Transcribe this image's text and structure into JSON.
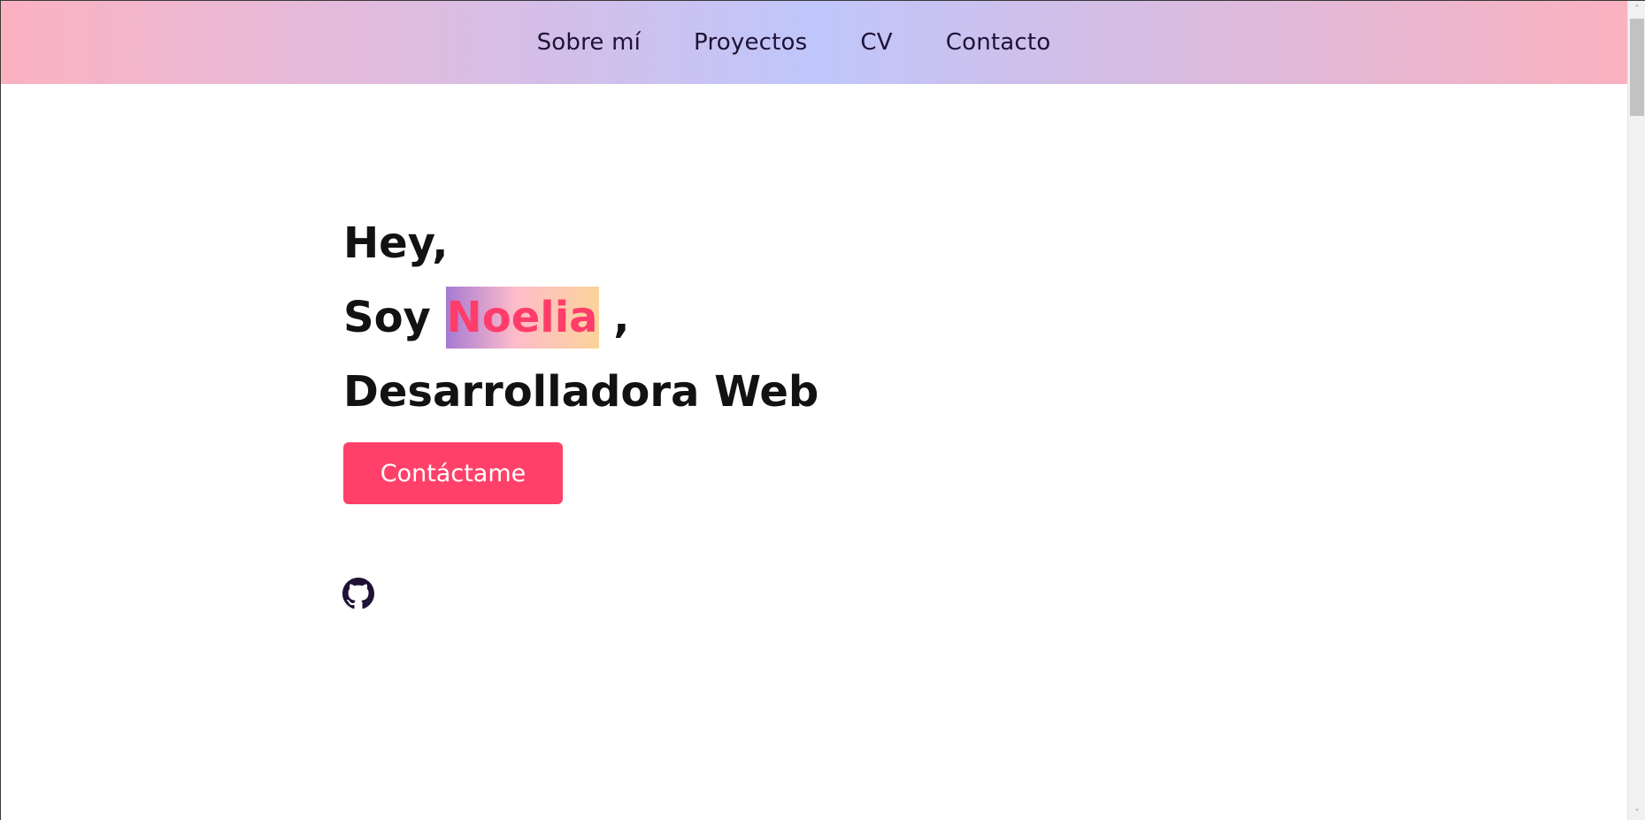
{
  "nav": {
    "items": [
      {
        "label": "Sobre mí"
      },
      {
        "label": "Proyectos"
      },
      {
        "label": "CV"
      },
      {
        "label": "Contacto"
      }
    ]
  },
  "hero": {
    "greeting": "Hey,",
    "intro_prefix": "Soy ",
    "name": "Noelia",
    "intro_suffix": " ,",
    "role": "Desarrolladora Web",
    "cta_label": "Contáctame"
  },
  "social": {
    "github_icon": "github-icon"
  },
  "colors": {
    "accent": "#ff4169",
    "name_text": "#ff3d6a",
    "heading_text": "#121212",
    "nav_text": "#1f1236",
    "nav_gradient_edges": "#fbb2c0",
    "nav_gradient_center": "#bfc6fb"
  },
  "scrollbar": {
    "up_glyph": "˄",
    "down_glyph": "˅"
  }
}
